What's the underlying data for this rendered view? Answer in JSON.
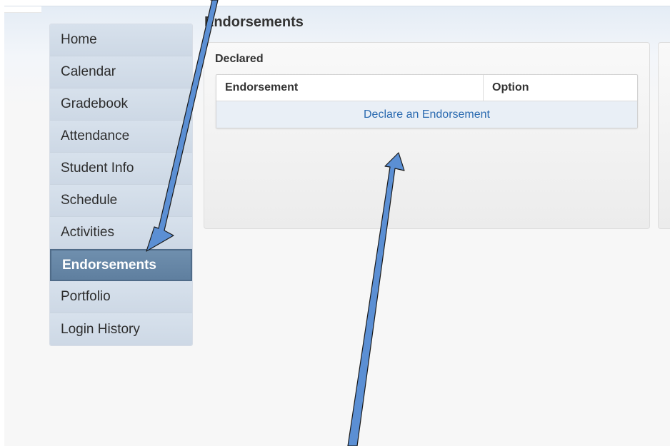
{
  "page": {
    "title": "Endorsements"
  },
  "nav": {
    "items": [
      {
        "label": "Home"
      },
      {
        "label": "Calendar"
      },
      {
        "label": "Gradebook"
      },
      {
        "label": "Attendance"
      },
      {
        "label": "Student Info"
      },
      {
        "label": "Schedule"
      },
      {
        "label": "Activities"
      },
      {
        "label": "Endorsements",
        "active": true
      },
      {
        "label": "Portfolio"
      },
      {
        "label": "Login History"
      }
    ]
  },
  "declared": {
    "heading": "Declared",
    "columns": [
      "Endorsement",
      "Option"
    ],
    "action_label": "Declare an Endorsement"
  },
  "colors": {
    "active_nav": "#6f8fae",
    "link": "#2a6ab0",
    "arrow_fill": "#5b8fd4",
    "arrow_stroke": "#1a1a1a"
  }
}
